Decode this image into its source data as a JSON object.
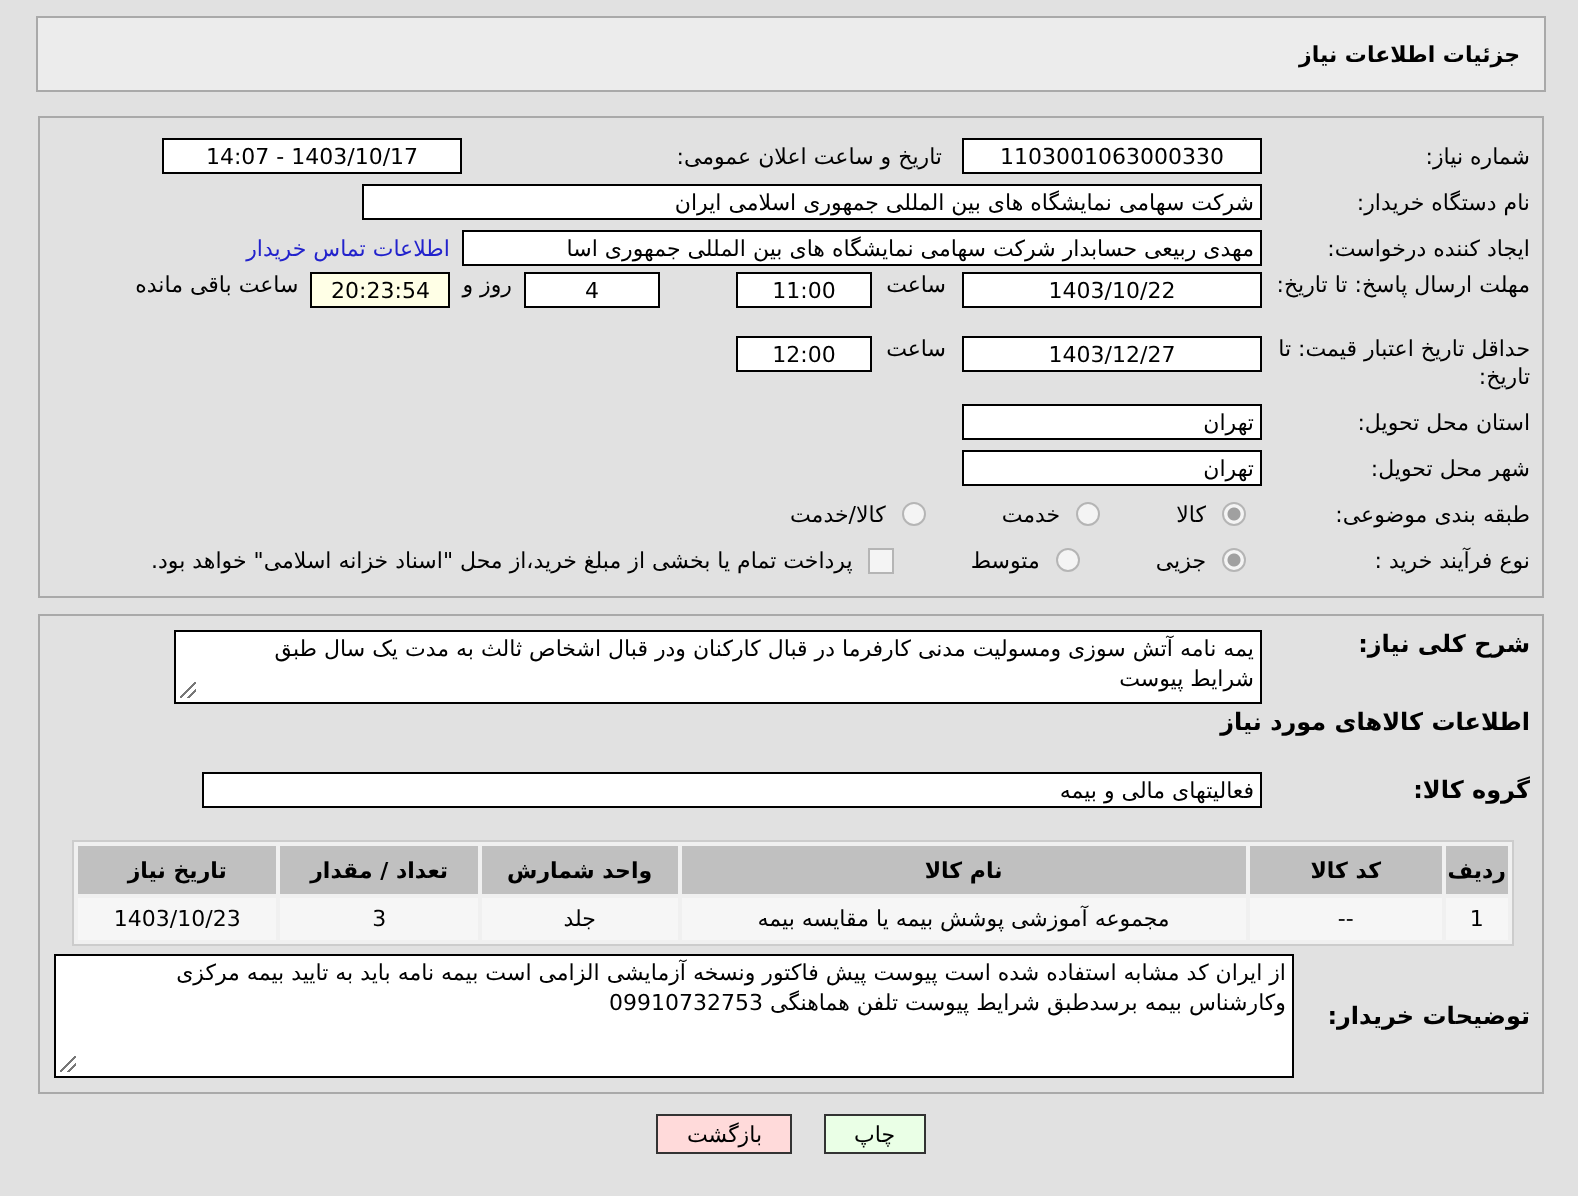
{
  "header": {
    "title": "جزئیات اطلاعات نیاز"
  },
  "need_number": {
    "label": "شماره نیاز:",
    "value": "1103001063000330"
  },
  "announce": {
    "label": "تاریخ و ساعت اعلان عمومی:",
    "value": "1403/10/17 - 14:07"
  },
  "buyer_org": {
    "label": "نام دستگاه خریدار:",
    "value": "شرکت سهامی نمایشگاه های بین المللی جمهوری اسلامی ایران"
  },
  "requester": {
    "label": "ایجاد کننده درخواست:",
    "value": "مهدی  ربیعی حسابدار شرکت سهامی نمایشگاه های بین المللی جمهوری اسا",
    "link": "اطلاعات تماس خریدار"
  },
  "deadline": {
    "label": "مهلت ارسال پاسخ: تا تاریخ:",
    "date": "1403/10/22",
    "time_label": "ساعت",
    "time": "11:00",
    "days": "4",
    "days_label": "روز و",
    "remaining": "20:23:54",
    "remaining_label": "ساعت باقی مانده"
  },
  "validity": {
    "label": "حداقل تاریخ اعتبار قیمت: تا تاریخ:",
    "date": "1403/12/27",
    "time_label": "ساعت",
    "time": "12:00"
  },
  "province": {
    "label": "استان محل تحویل:",
    "value": "تهران"
  },
  "city": {
    "label": "شهر محل تحویل:",
    "value": "تهران"
  },
  "category": {
    "label": "طبقه بندی موضوعی:",
    "options": [
      {
        "label": "کالا",
        "selected": true
      },
      {
        "label": "خدمت",
        "selected": false
      },
      {
        "label": "کالا/خدمت",
        "selected": false
      }
    ]
  },
  "process": {
    "label": "نوع فرآیند خرید :",
    "options": [
      {
        "label": "جزیی",
        "selected": true
      },
      {
        "label": "متوسط",
        "selected": false
      }
    ],
    "payment": {
      "checked": false,
      "text": "پرداخت تمام یا بخشی از مبلغ خرید،از محل \"اسناد خزانه اسلامی\" خواهد بود."
    }
  },
  "description": {
    "label": "شرح کلی نیاز:",
    "text": "یمه نامه آتش سوزی ومسولیت مدنی کارفرما در قبال کارکنان ودر قبال اشخاص ثالث به مدت یک سال طبق شرایط پیوست"
  },
  "goods_heading": "اطلاعات کالاهای مورد نیاز",
  "goods_group": {
    "label": "گروه کالا:",
    "value": "فعالیتهای مالی و بیمه"
  },
  "table": {
    "columns": [
      "ردیف",
      "کد کالا",
      "نام کالا",
      "واحد شمارش",
      "تعداد / مقدار",
      "تاریخ نیاز"
    ],
    "rows": [
      [
        "1",
        "--",
        "مجموعه آموزشی پوشش بیمه یا مقایسه بیمه",
        "جلد",
        "3",
        "1403/10/23"
      ]
    ]
  },
  "buyer_notes": {
    "label": "توضیحات خریدار:",
    "text": "از ایران کد مشابه استفاده شده است پیوست پیش فاکتور ونسخه آزمایشی الزامی است بیمه نامه باید به تایید بیمه مرکزی وکارشناس بیمه برسدطبق شرایط پیوست تلفن هماهنگی 09910732753"
  },
  "buttons": [
    {
      "label": "چاپ",
      "kind": "print"
    },
    {
      "label": "بازگشت",
      "kind": "back"
    }
  ]
}
